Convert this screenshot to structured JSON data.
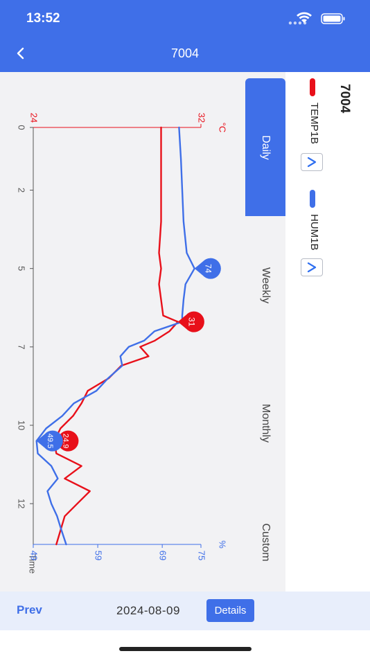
{
  "status_bar": {
    "time": "13:52",
    "icons": [
      "signal-icon",
      "wifi-icon",
      "battery-icon"
    ]
  },
  "nav": {
    "title": "7004",
    "back_icon": "chevron-left-icon"
  },
  "legend": {
    "device_name": "7004",
    "series": [
      {
        "label": "TEMP1B",
        "color": "#e8101a",
        "checked": true
      },
      {
        "label": "HUM1B",
        "color": "#3f6fe8",
        "checked": true
      }
    ]
  },
  "tabs": [
    {
      "label": "Daily",
      "active": true
    },
    {
      "label": "Weekly",
      "active": false
    },
    {
      "label": "Monthly",
      "active": false
    },
    {
      "label": "Custom",
      "active": false
    }
  ],
  "bottom": {
    "prev_label": "Prev",
    "date": "2024-08-09",
    "details_label": "Details"
  },
  "colors": {
    "accent": "#3f6fe8",
    "temp": "#e8101a",
    "hum": "#3f6fe8"
  },
  "chart_data": {
    "type": "line",
    "orientation": "rotated-90",
    "xlabel": "Time",
    "x_ticks": [
      "0",
      "2",
      "5",
      "7",
      "10",
      "12"
    ],
    "x_tick_values": [
      0,
      2,
      4.5,
      7,
      9.5,
      12
    ],
    "xlim": [
      0,
      13.3
    ],
    "axes": {
      "temp": {
        "unit": "°C",
        "min_label": "24",
        "max_label": "32",
        "min": 24,
        "max": 32
      },
      "hum": {
        "unit": "%",
        "ticks": [
          "49",
          "59",
          "69",
          "75"
        ],
        "tick_values": [
          49,
          59,
          69,
          75
        ],
        "min": 49,
        "max": 75
      }
    },
    "grid": false,
    "series": [
      {
        "name": "TEMP1B",
        "axis": "temp",
        "color": "#e8101a",
        "x": [
          0,
          1,
          2,
          3,
          4,
          4.5,
          5,
          5.5,
          6,
          6.2,
          6.5,
          6.8,
          7,
          7.3,
          7.6,
          8,
          8.4,
          8.8,
          9.2,
          9.6,
          10,
          10.4,
          10.8,
          11.2,
          11.6,
          12,
          12.4,
          13.3
        ],
        "y": [
          30.1,
          30.1,
          30.1,
          30.1,
          30.0,
          30.1,
          30.0,
          30.1,
          30.2,
          30.9,
          30.5,
          29.8,
          29.1,
          29.5,
          28.2,
          27.6,
          26.6,
          26.3,
          25.9,
          25.3,
          25.0,
          25.1,
          26.3,
          25.5,
          26.7,
          26.1,
          25.5,
          25.1
        ]
      },
      {
        "name": "HUM1B",
        "axis": "hum",
        "color": "#3f6fe8",
        "x": [
          0,
          1,
          2,
          3,
          4,
          4.5,
          5,
          5.5,
          6,
          6.2,
          6.5,
          6.8,
          7,
          7.3,
          7.6,
          8,
          8.4,
          8.8,
          9.2,
          9.6,
          10,
          10.4,
          10.8,
          11.2,
          11.6,
          12,
          12.4,
          12.8,
          13.3
        ],
        "y": [
          71.6,
          71.9,
          72.1,
          72.3,
          72.8,
          74.0,
          72.6,
          72.3,
          72.1,
          72.1,
          67.8,
          66.2,
          63.8,
          62.5,
          62.8,
          60.6,
          58.8,
          55.3,
          53.5,
          51.0,
          49.5,
          49.7,
          51.8,
          52.8,
          51.2,
          51.8,
          52.7,
          53.3,
          54.1
        ]
      }
    ],
    "markers": [
      {
        "series": "HUM1B",
        "label": "74",
        "x": 4.5,
        "y": 74.0
      },
      {
        "series": "TEMP1B",
        "label": "31",
        "x": 6.2,
        "y": 30.9
      },
      {
        "series": "TEMP1B",
        "label": "24.9",
        "x": 10.0,
        "y": 24.9
      },
      {
        "series": "HUM1B",
        "label": "49.5",
        "x": 10.0,
        "y": 49.5
      }
    ]
  }
}
